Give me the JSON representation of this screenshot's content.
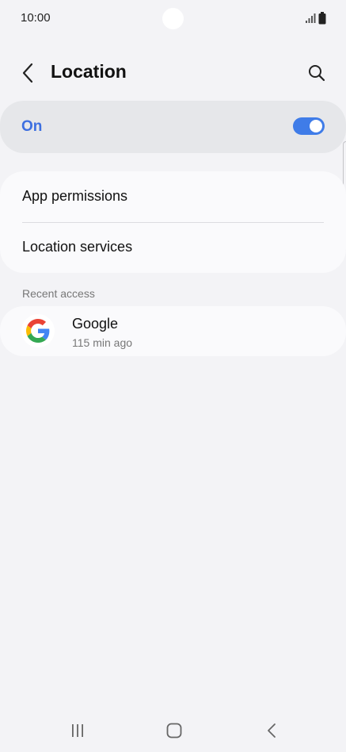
{
  "status_bar": {
    "time": "10:00",
    "icons": [
      "signal-icon",
      "battery-icon"
    ]
  },
  "header": {
    "title": "Location",
    "back_icon": "chevron-left-icon",
    "search_icon": "search-icon"
  },
  "master_switch": {
    "label": "On",
    "state": "on",
    "accent_color": "#3f7ce8"
  },
  "menu": {
    "items": [
      {
        "label": "App permissions"
      },
      {
        "label": "Location services"
      }
    ]
  },
  "recent_access": {
    "header": "Recent access",
    "apps": [
      {
        "name": "Google",
        "subtitle": "115 min ago",
        "icon": "google-icon"
      }
    ]
  },
  "nav_bar": {
    "icons": [
      "recents-icon",
      "home-icon",
      "back-icon"
    ]
  }
}
